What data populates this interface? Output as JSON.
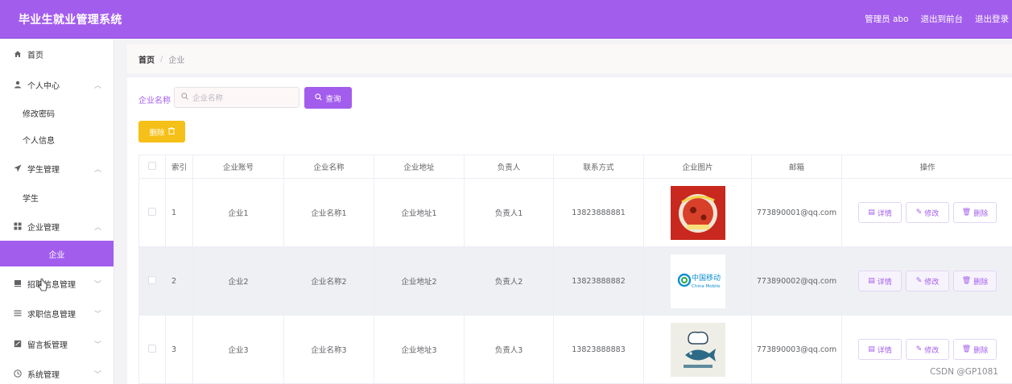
{
  "header": {
    "title": "毕业生就业管理系统",
    "admin": "管理员 abo",
    "back_front": "退出到前台",
    "logout": "退出登录"
  },
  "sidebar": {
    "home": "首页",
    "personal_center": "个人中心",
    "change_password": "修改密码",
    "personal_info": "个人信息",
    "student_mgmt": "学生管理",
    "student": "学生",
    "company_mgmt": "企业管理",
    "company": "企业",
    "recruit_mgmt": "招聘信息管理",
    "jobseek_mgmt": "求职信息管理",
    "message_mgmt": "留言板管理",
    "system_mgmt": "系统管理"
  },
  "breadcrumb": {
    "home": "首页",
    "sep": "/",
    "current": "企业"
  },
  "search": {
    "label": "企业名称",
    "placeholder": "企业名称",
    "button": "查询"
  },
  "delete_button": "删除",
  "table": {
    "columns": {
      "index": "索引",
      "account": "企业账号",
      "name": "企业名称",
      "address": "企业地址",
      "contact_person": "负责人",
      "phone": "联系方式",
      "image": "企业图片",
      "email": "邮箱",
      "ops": "操作"
    },
    "rows": [
      {
        "index": "1",
        "account": "企业1",
        "name": "企业名称1",
        "address": "企业地址1",
        "contact_person": "负责人1",
        "phone": "13823888881",
        "email": "773890001@qq.com"
      },
      {
        "index": "2",
        "account": "企业2",
        "name": "企业名称2",
        "address": "企业地址2",
        "contact_person": "负责人2",
        "phone": "13823888882",
        "email": "773890002@qq.com"
      },
      {
        "index": "3",
        "account": "企业3",
        "name": "企业名称3",
        "address": "企业地址3",
        "contact_person": "负责人3",
        "phone": "13823888883",
        "email": "773890003@qq.com"
      }
    ],
    "ops": {
      "detail": "详情",
      "edit": "修改",
      "delete": "删除"
    }
  },
  "image2_text": {
    "cn": "中国移动",
    "en": "China Mobile"
  },
  "watermark": "CSDN @GP1081",
  "colors": {
    "accent": "#a35ded",
    "warning": "#f5c017"
  }
}
